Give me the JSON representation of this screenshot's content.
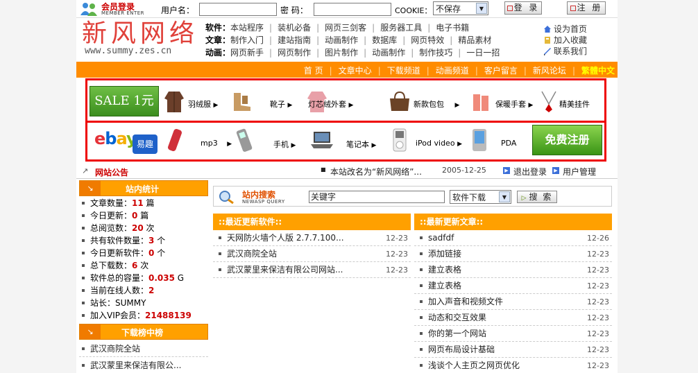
{
  "login": {
    "title": "会员登录",
    "subtitle": "MEMBER ENTER",
    "username_label": "用户名：",
    "password_label": "密 码：",
    "cookie_label": "COOKIE：",
    "cookie_value": "不保存",
    "login_button": "登 录",
    "register_button": "注 册"
  },
  "header": {
    "logo": "新风网络",
    "url": "www.summy.zes.cn",
    "nav": [
      {
        "cat": "软件：",
        "items": [
          "本站程序",
          "装机必备",
          "网页三剑客",
          "服务器工具",
          "电子书籍"
        ]
      },
      {
        "cat": "文章：",
        "items": [
          "制作入门",
          "建站指南",
          "动画制作",
          "数据库",
          "网页特效",
          "精品素材"
        ]
      },
      {
        "cat": "动画：",
        "items": [
          "网页新手",
          "网页制作",
          "图片制作",
          "动画制作",
          "制作技巧",
          "一日一招"
        ]
      }
    ],
    "quick": [
      "设为首页",
      "加入收藏",
      "联系我们"
    ]
  },
  "topnav": [
    "首 页",
    "文章中心",
    "下载频道",
    "动画频道",
    "客户留言",
    "新风论坛"
  ],
  "topnav_hot": "繁體中文",
  "ad": {
    "sale": "SALE 1元",
    "row1": [
      "羽绒服",
      "靴子",
      "灯芯绒外套",
      "新款包包",
      "保暖手套",
      "精美挂件"
    ],
    "row2": [
      "mp3",
      "手机",
      "笔记本",
      "iPod video",
      "PDA"
    ],
    "ebay": "ebay",
    "ebay_cn": "易趣",
    "free": "免费注册"
  },
  "notice": {
    "title": "网站公告",
    "text": "本站改名为“新风网络”...",
    "date": "2005-12-25",
    "logout": "退出登录",
    "usermgmt": "用户管理"
  },
  "stats": {
    "title": "站内统计",
    "rows": [
      {
        "label": "文章数量：",
        "value": "11",
        "unit": " 篇"
      },
      {
        "label": "今日更新：",
        "value": "0",
        "unit": " 篇"
      },
      {
        "label": "总阅览数：",
        "value": "20",
        "unit": " 次"
      },
      {
        "label": "共有软件数量：",
        "value": "3",
        "unit": " 个"
      },
      {
        "label": "今日更新软件：",
        "value": "0",
        "unit": " 个"
      },
      {
        "label": "总下载数：",
        "value": "6",
        "unit": " 次"
      },
      {
        "label": "软件总的容量：",
        "value": "0.035",
        "unit": " G"
      },
      {
        "label": "当前在线人数：",
        "value": "2",
        "unit": ""
      },
      {
        "label": "站长：SUMMY",
        "value": "",
        "unit": ""
      },
      {
        "label": "加入VIP会员：",
        "value": "21488139",
        "unit": ""
      }
    ]
  },
  "download_rank": {
    "title": "下载榜中榜",
    "items": [
      "武汉商院全站",
      "武汉蒙里来保洁有限公..."
    ]
  },
  "search": {
    "title": "站内搜索",
    "subtitle": "NEWASP QUERY",
    "keyword": "关键字",
    "type": "软件下载",
    "button": "搜 索"
  },
  "soft": {
    "title": "::最近更新软件::",
    "items": [
      {
        "t": "天网防火墙个人版 2.7.7.100...",
        "d": "12-23"
      },
      {
        "t": "武汉商院全站",
        "d": "12-23"
      },
      {
        "t": "武汉蒙里来保洁有限公司网站...",
        "d": "12-23"
      }
    ]
  },
  "articles": {
    "title": "::最新更新文章::",
    "items": [
      {
        "t": "sadfdf",
        "d": "12-26"
      },
      {
        "t": "添加链接",
        "d": "12-23"
      },
      {
        "t": "建立表格",
        "d": "12-23"
      },
      {
        "t": "建立表格",
        "d": "12-23"
      },
      {
        "t": "加入声音和视频文件",
        "d": "12-23"
      },
      {
        "t": "动态和交互效果",
        "d": "12-23"
      },
      {
        "t": "你的第一个网站",
        "d": "12-23"
      },
      {
        "t": "网页布局设计基础",
        "d": "12-23"
      },
      {
        "t": "浅谈个人主页之网页优化",
        "d": "12-23"
      }
    ]
  },
  "colors": {
    "orange": "#ffa000",
    "nav": "#ff8c00",
    "red": "#e00000",
    "green": "#3b8e1e"
  }
}
